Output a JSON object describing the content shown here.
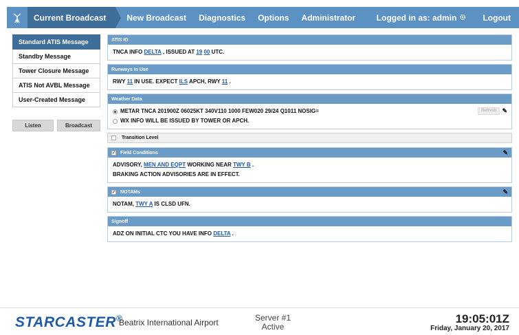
{
  "nav": {
    "tabs": [
      {
        "label": "Current Broadcast"
      },
      {
        "label": "New Broadcast"
      },
      {
        "label": "Diagnostics"
      },
      {
        "label": "Options"
      },
      {
        "label": "Administrator"
      }
    ],
    "logged_in": "Logged in as: admin",
    "logout": "Logout",
    "icons": {
      "logo": "antenna-icon",
      "settings": "gear-icon"
    }
  },
  "sidebar": {
    "items": [
      {
        "label": "Standard ATIS Message",
        "selected": true
      },
      {
        "label": "Standby Message"
      },
      {
        "label": "Tower Closure Message"
      },
      {
        "label": "ATIS Not AVBL Message"
      },
      {
        "label": "User-Created Message"
      }
    ],
    "listen": "Listen",
    "broadcast": "Broadcast"
  },
  "panels": {
    "atis_id": {
      "title": "ATIS ID",
      "t1": "TNCA INFO ",
      "info": "DELTA",
      "t2": " , ISSUED AT ",
      "hh": "19",
      "mm": "00",
      "t3": " UTC."
    },
    "runways": {
      "title": "Runways In Use",
      "t1": "RWY ",
      "rwy1": "11",
      "t2": " IN USE. EXPECT ",
      "appr": "ILS",
      "t3": " APCH, RWY ",
      "rwy2": "11",
      "t4": " ."
    },
    "weather": {
      "title": "Weather Data",
      "metar": "METAR TNCA 201900Z 06025KT 340V110 1000 FEW020 29/24 Q1011 NOSIG=",
      "wx": "WX INFO WILL BE ISSUED BY TOWER OR APCH.",
      "refresh": "Refresh"
    },
    "transition": {
      "title": "Transition Level"
    },
    "field": {
      "title": "Field Conditions",
      "t1": "ADVISORY, ",
      "l1": "MEN AND EQPT",
      "t2": " WORKING NEAR ",
      "l2": "TWY B",
      "t3": " .",
      "line2": "BRAKING ACTION ADVISORIES ARE IN EFFECT."
    },
    "notams": {
      "title": "NOTAMs",
      "t1": "NOTAM, ",
      "l1": "TWY A",
      "t2": " IS CLSD UFN."
    },
    "signoff": {
      "title": "Signoff",
      "t1": "ADZ ON INITIAL CTC YOU HAVE INFO ",
      "l1": "DELTA",
      "t2": " ."
    }
  },
  "footer": {
    "brand": "STARCASTER",
    "reg": "®",
    "airport": "Beatrix International Airport",
    "server": "Server #1",
    "server_status": "Active",
    "time": "19:05:01Z",
    "date": "Friday, January 20, 2017"
  },
  "colors": {
    "nav": "#5b92c3",
    "nav_dark": "#3f6e9b",
    "panel_header": "#6b9cc8",
    "link": "#1e5aa8"
  }
}
